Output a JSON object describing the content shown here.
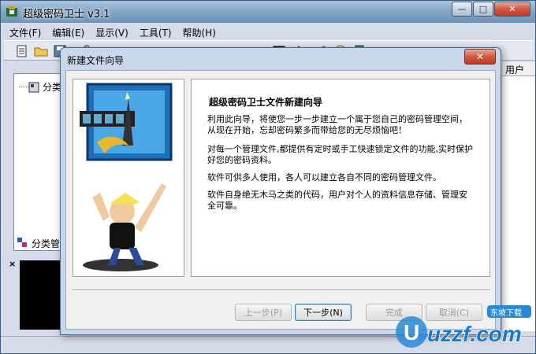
{
  "window": {
    "title": "超级密码卫士 v3.1",
    "min_label": "—",
    "max_label": "□",
    "close_label": "✕"
  },
  "menu": {
    "items": [
      "文件(F)",
      "编辑(E)",
      "显示(V)",
      "工具(T)",
      "帮助(H)"
    ]
  },
  "tree": {
    "root_label": "分类"
  },
  "tabs": {
    "category_tab": "分类管"
  },
  "right_panel": {
    "header": "用户"
  },
  "dialog": {
    "title": "新建文件向导",
    "close_label": "✕",
    "heading": "超级密码卫士文件新建向导",
    "paragraphs": [
      "利用此向导，将使您一步一步建立一个属于您自己的密码管理空间，从现在开始，忘却密码繁多而带给您的无尽烦恼吧！",
      "对每一个管理文件,都提供有定时或手工快速锁定文件的功能,实时保护好您的密码资料。",
      "软件可供多人使用，各人可以建立各自不同的密码管理文件。",
      "软件自身绝无木马之类的代码，用户对个人的资料信息存储、管理安全可靠。"
    ],
    "buttons": {
      "prev": "上一步(P)",
      "next": "下一步(N)",
      "finish": "完成",
      "cancel": "取消(C)"
    }
  },
  "watermark": {
    "text": "uzzf.com",
    "badge": "东坡下载"
  }
}
